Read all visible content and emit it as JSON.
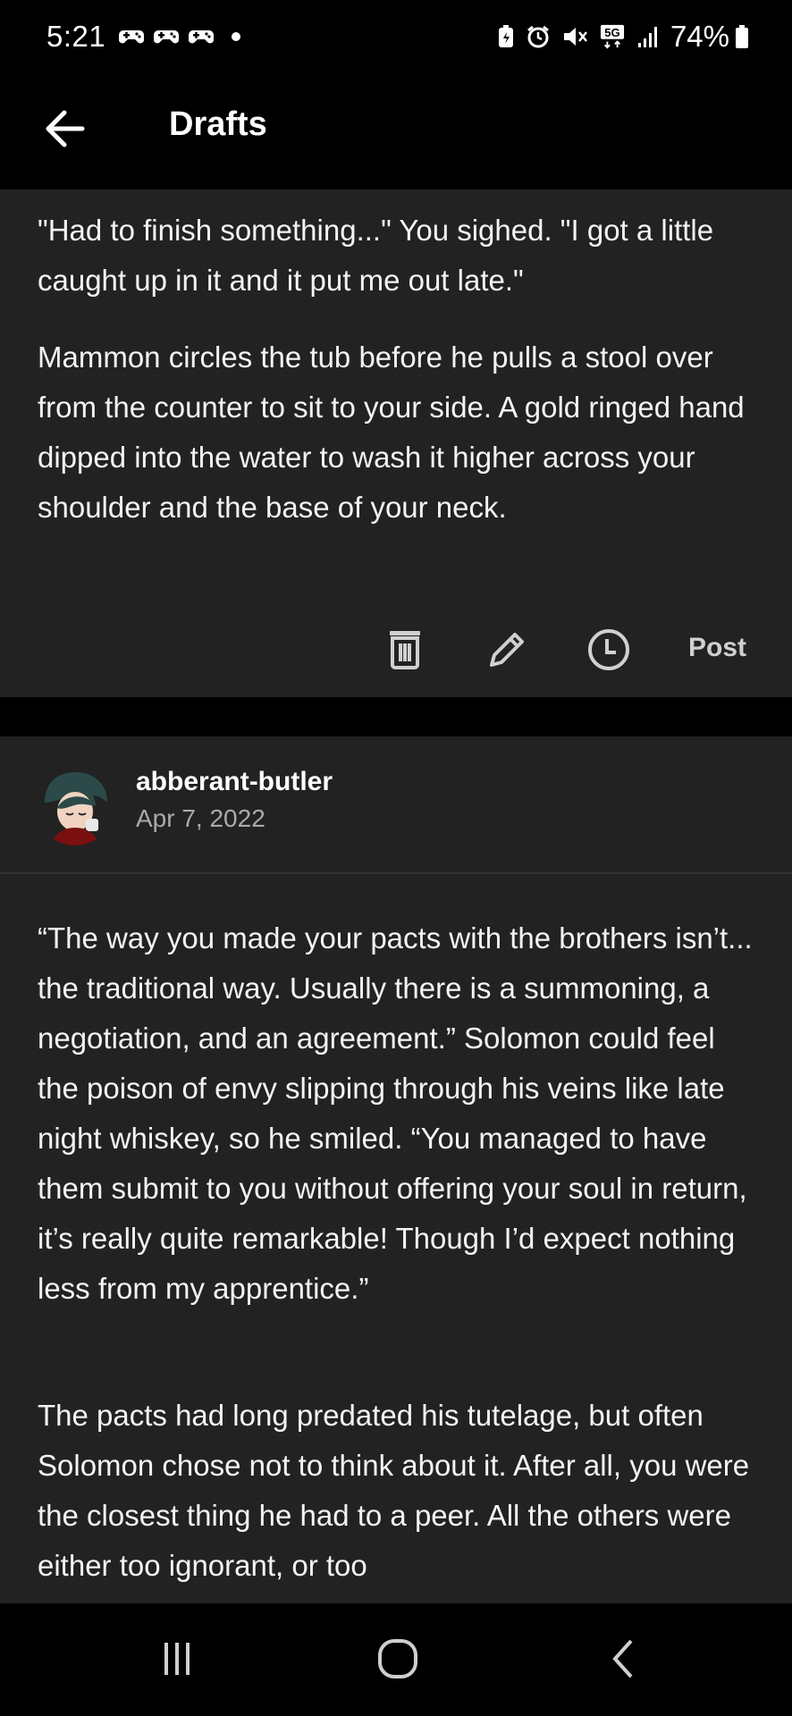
{
  "status_bar": {
    "time": "5:21",
    "left_icons": [
      "game-controller-icon",
      "game-controller-icon",
      "game-controller-icon",
      "notification-dot-icon"
    ],
    "right_icons": [
      "battery-saver-icon",
      "alarm-icon",
      "mute-icon",
      "5g-icon",
      "signal-icon"
    ],
    "network": "5G",
    "battery": "74%"
  },
  "header": {
    "title": "Drafts",
    "back_icon": "arrow-left-icon"
  },
  "draft_card": {
    "paragraphs": [
      "\"Had to finish something...\" You sighed. \"I got a little caught up in it and it put me out late.\"",
      "Mammon circles the tub before he pulls a stool over from the counter to sit to your side. A gold ringed hand dipped into the water to wash it higher across your shoulder and the base of your neck."
    ],
    "actions": {
      "delete_icon": "trash-icon",
      "edit_icon": "pencil-icon",
      "schedule_icon": "clock-icon",
      "post_label": "Post"
    }
  },
  "post_card": {
    "author": "abberant-butler",
    "date": "Apr 7, 2022",
    "paragraphs": [
      "“The way you made your pacts with the brothers isn’t... the traditional way. Usually there is a summoning, a negotiation, and an agreement.” Solomon could feel the poison of envy slipping through his veins like late night whiskey, so he smiled. “You managed to have them submit to you without offering your soul in return, it’s really quite remarkable! Though I’d expect nothing less from my apprentice.”",
      "The pacts had long predated his tutelage, but often Solomon chose not to think about it. After all, you were the closest thing he had to a peer. All the others were either too ignorant, or too"
    ]
  },
  "nav_bar": {
    "recents_icon": "recent-apps-icon",
    "home_icon": "home-icon",
    "back_icon": "back-chevron-icon"
  },
  "colors": {
    "background": "#000000",
    "card": "#222222",
    "text": "#f3f3f3",
    "muted": "#aaaaaa"
  }
}
